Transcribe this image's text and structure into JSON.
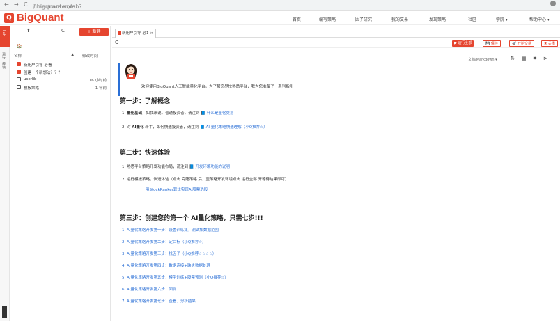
{
  "browser": {
    "back": "←",
    "forward": "→",
    "reload": "C",
    "lock": "🔒",
    "url_host": "i.bigquant.com",
    "url_path": "/user/runsen/lab?"
  },
  "header": {
    "logo_mark": "Q",
    "logo_text": "BigQuant",
    "nav": [
      "首页",
      "编写策略",
      "因子研究",
      "我的交易",
      "发现策略",
      "社区",
      "学院 ▾",
      "帮助中心 ▾"
    ]
  },
  "strip": {
    "label_top": "Lab",
    "label_mid": "运行",
    "label_b": "模块"
  },
  "panel": {
    "upload": "⬆",
    "refresh": "C",
    "new_button": "+ 新建",
    "home": "🏠",
    "col_name": "名称",
    "col_sort": "▲",
    "col_modified": "修改时间",
    "files": [
      {
        "name": "新用户引导-必看",
        "time": "",
        "type": "notebook"
      },
      {
        "name": "创建一个新想法？？？",
        "time": "",
        "type": "notebook"
      },
      {
        "name": "userlib",
        "time": "16 小时前",
        "type": "folder"
      },
      {
        "name": "模板策略",
        "time": "1 年前",
        "type": "folder"
      }
    ]
  },
  "tab": {
    "label": "新用户引导-必1",
    "close": "×"
  },
  "toolbar": {
    "run_all": "▶ 运行全部",
    "save": "💾 保存",
    "start_trade": "🚀 开始交易",
    "close": "✖ 关闭",
    "doc_type": "文档/Markdown ▾",
    "circle": "O"
  },
  "content": {
    "welcome": "欢迎使用BigQuant人工智能量化平台。为了帮您尽快熟悉平台，我为您准备了一系列指引",
    "step1_title": "第一步：了解概念",
    "step1_items": [
      {
        "prefix": "1. ",
        "bold": "量化基础",
        "text": "，如我来说，普通投资者，请注到 ",
        "link": "什么是量化交易"
      },
      {
        "prefix": "2. 对 ",
        "bold": "AI量化",
        "text": " 新手，如何快速投资者，请注到 ",
        "link": "AI 量化策略快速理解（小Q推荐☆）"
      }
    ],
    "step2_title": "第二步：快速体验",
    "step2_items": [
      {
        "prefix": "1. ",
        "text": "熟悉平台策略开发功能布局，请注到 ",
        "link": "开发环境功能的说明"
      },
      {
        "prefix": "2. ",
        "text": "运行模板策略，快速体验（点击 克隆策略 后，至策略开发环境点击 运行全部 开等待结果即可）",
        "link": ""
      }
    ],
    "step2_sub": "用StockRanker算法实现AI股票选股",
    "step3_title": "第三步：创建您的第一个 AI量化策略，只需七步!!!",
    "step3_items": [
      "1. AI量化策略开发第一步：设置训练集，测试集数据范围",
      "2. AI量化策略开发第二步：定目标（小Q推荐☆）",
      "3. AI量化策略开发第三步：找因子（小Q推荐☆☆☆☆）",
      "4. AI量化策略开发第四步：数据连接+缺失数据处理",
      "5. AI量化策略开发第五步：模型训练+股票预测（小Q推荐☆）",
      "6. AI量化策略开发第六步：回测",
      "7. AI量化策略开发第七步：查看、分析结果"
    ]
  },
  "colors": {
    "brand_red": "#e5452f",
    "link_blue": "#2a6fd6"
  }
}
